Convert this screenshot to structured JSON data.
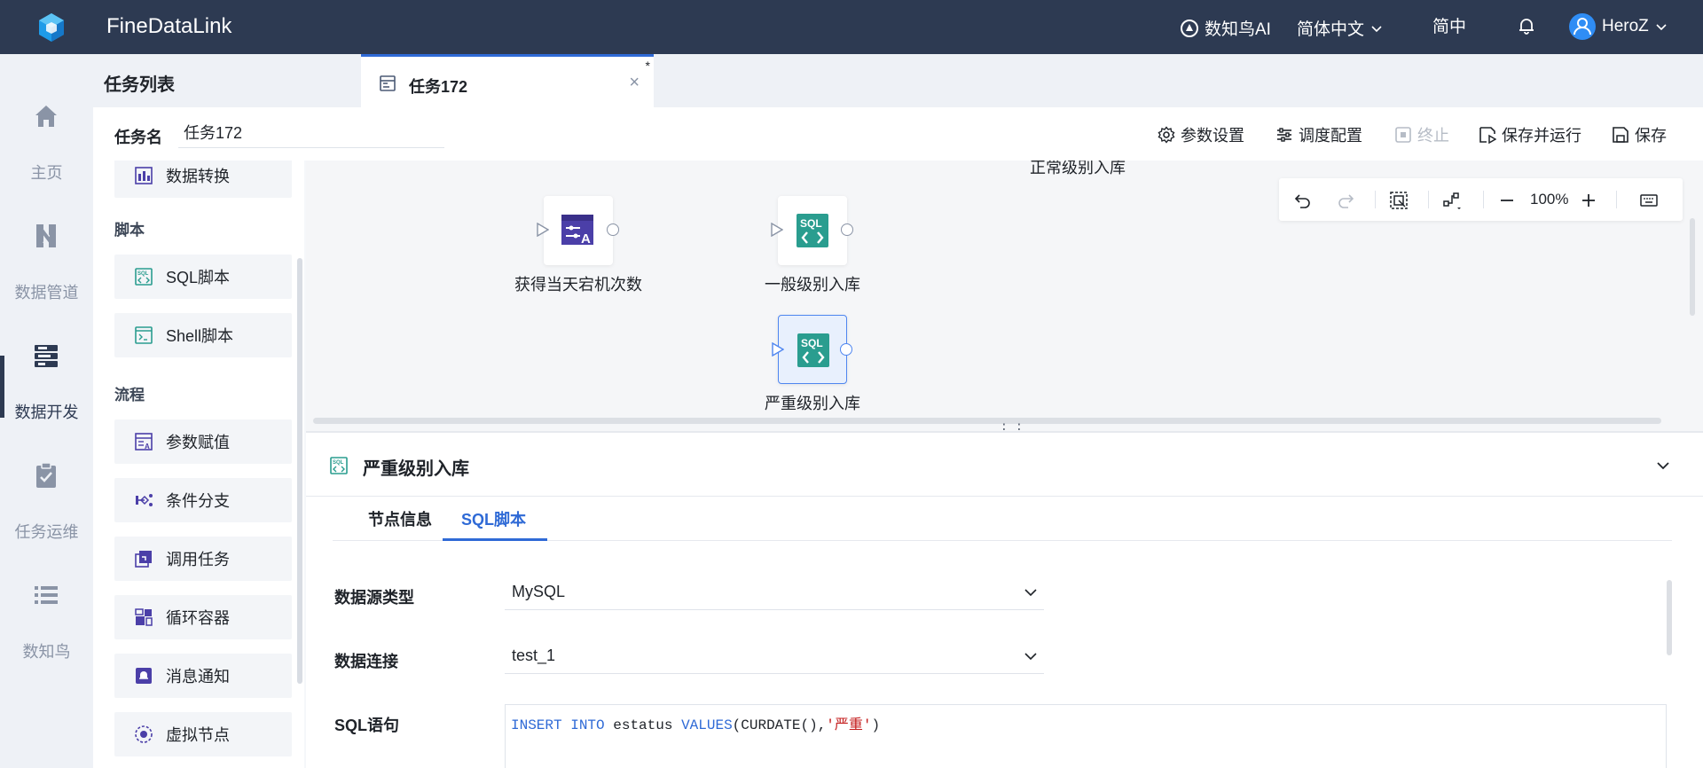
{
  "topbar": {
    "app_title": "FineDataLink",
    "ai_label": "数知鸟AI",
    "language": "简体中文",
    "input_mode": "简中",
    "user_name": "HeroZ"
  },
  "leftnav": {
    "items": [
      {
        "label": "主页",
        "icon": "home-icon"
      },
      {
        "label": "数据管道",
        "icon": "pipeline-icon"
      },
      {
        "label": "数据开发",
        "icon": "dev-icon",
        "active": true
      },
      {
        "label": "任务运维",
        "icon": "ops-icon"
      },
      {
        "label": "数知鸟",
        "icon": "list-icon"
      }
    ]
  },
  "tabs": {
    "panel_title": "任务列表",
    "active_tab": "任务172",
    "modified_marker": "*",
    "close": "×"
  },
  "taskbar": {
    "name_label": "任务名",
    "name_value": "任务172",
    "buttons": {
      "params": "参数设置",
      "schedule": "调度配置",
      "stop": "终止",
      "save_run": "保存并运行",
      "save": "保存"
    }
  },
  "components": {
    "partial_top": "数据转换",
    "section_script": "脚本",
    "sql_script": "SQL脚本",
    "shell_script": "Shell脚本",
    "section_flow": "流程",
    "param_assign": "参数赋值",
    "condition_branch": "条件分支",
    "invoke_task": "调用任务",
    "loop_container": "循环容器",
    "message_notify": "消息通知",
    "virtual_node": "虚拟节点"
  },
  "canvas": {
    "top_partial_label": "正常级别入库",
    "nodes": [
      {
        "label": "获得当天宕机次数",
        "type": "param-assign"
      },
      {
        "label": "一般级别入库",
        "type": "sql"
      },
      {
        "label": "严重级别入库",
        "type": "sql",
        "selected": true
      }
    ],
    "zoom_level": "100%",
    "splitter": "⋮⋮"
  },
  "detail": {
    "title": "严重级别入库",
    "tabs": [
      "节点信息",
      "SQL脚本"
    ],
    "active_tab": "SQL脚本",
    "fields": {
      "datasource_type_label": "数据源类型",
      "datasource_type_value": "MySQL",
      "connection_label": "数据连接",
      "connection_value": "test_1",
      "sql_label": "SQL语句"
    },
    "sql": {
      "kw1": "INSERT",
      "kw2": "INTO",
      "table": "estatus",
      "kw3": "VALUES",
      "func": "(CURDATE(),",
      "str": "'严重'",
      "end": ")"
    }
  },
  "colors": {
    "topbar_bg": "#2d3a52",
    "accent": "#2f6ad6",
    "sql_icon": "#2a9d8f",
    "param_icon": "#4b3fa8"
  }
}
